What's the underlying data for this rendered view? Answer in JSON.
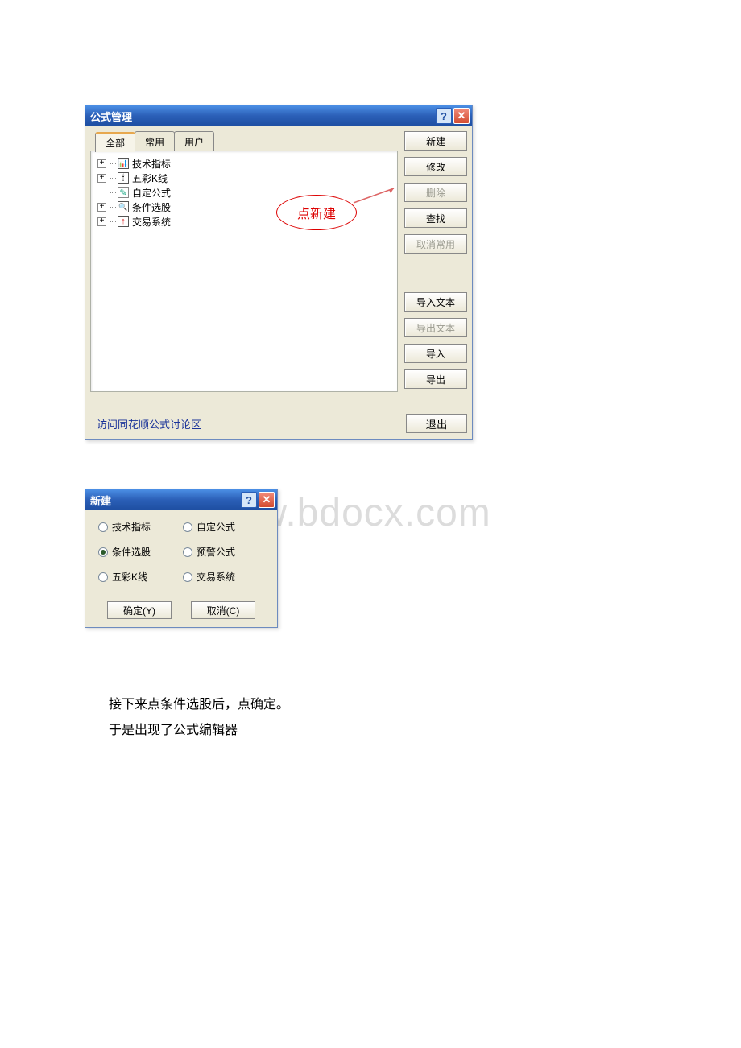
{
  "dialog1": {
    "title": "公式管理",
    "tabs": [
      "全部",
      "常用",
      "用户"
    ],
    "tree": [
      {
        "expandable": true,
        "icon": "ic-bars",
        "label": "技术指标"
      },
      {
        "expandable": true,
        "icon": "ic-candle",
        "label": "五彩K线"
      },
      {
        "expandable": false,
        "icon": "ic-pencil",
        "label": "自定公式"
      },
      {
        "expandable": true,
        "icon": "ic-binoc",
        "label": "条件选股"
      },
      {
        "expandable": true,
        "icon": "ic-arrow",
        "label": "交易系统"
      }
    ],
    "buttons": {
      "new": "新建",
      "modify": "修改",
      "delete": "删除",
      "find": "查找",
      "unfav": "取消常用",
      "import_text": "导入文本",
      "export_text": "导出文本",
      "import": "导入",
      "export": "导出",
      "exit": "退出"
    },
    "footer_link": "访问同花顺公式讨论区",
    "callout": "点新建"
  },
  "dialog2": {
    "title": "新建",
    "options": [
      {
        "label": "技术指标",
        "selected": false
      },
      {
        "label": "自定公式",
        "selected": false
      },
      {
        "label": "条件选股",
        "selected": true
      },
      {
        "label": "预警公式",
        "selected": false
      },
      {
        "label": "五彩K线",
        "selected": false
      },
      {
        "label": "交易系统",
        "selected": false
      }
    ],
    "ok": "确定(Y)",
    "cancel": "取消(C)"
  },
  "doc": {
    "p1": "接下来点条件选股后，点确定。",
    "p2": "于是出现了公式编辑器"
  },
  "watermark": "www.bdocx.com",
  "glyphs": {
    "help": "?",
    "close": "✕",
    "plus": "+"
  }
}
